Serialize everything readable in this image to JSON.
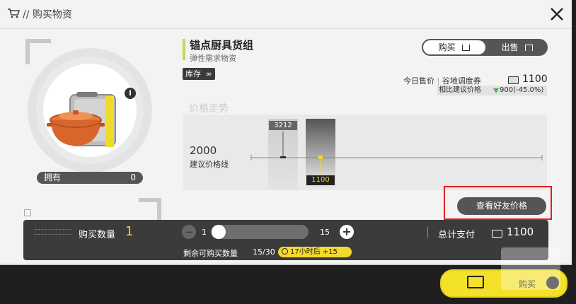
{
  "header": {
    "breadcrumb": "// 购买物资"
  },
  "item": {
    "name": "锚点厨具货组",
    "category": "弹性需求物资",
    "stock_label": "库存",
    "stock_value": "∞",
    "owned_label": "拥有",
    "owned_value": "0"
  },
  "trade_toggle": {
    "buy": "购买",
    "sell": "出售"
  },
  "price": {
    "today_label": "今日售价",
    "currency_label": "谷地调度券",
    "today_value": "1100",
    "compare_label": "相比建议价格",
    "compare_value": "900(-45.0%)"
  },
  "trend": {
    "title": "价格走势",
    "suggested_value": "2000",
    "suggested_label": "建议价格线",
    "bars": [
      {
        "label": "3212",
        "value": 3212
      },
      {
        "label": "1100",
        "value": 1100
      }
    ]
  },
  "friend_button": "查看好友价格",
  "purchase": {
    "qty_label": "购买数量",
    "qty_value": "1",
    "min": "1",
    "max": "15",
    "total_label": "总计支付",
    "total_value": "1100",
    "remain_label": "剩余可购买数量",
    "remain_value": "15/30",
    "timer": "17小时后 +15"
  },
  "buy_button": "购买",
  "colors": {
    "accent": "#f3da2c",
    "green": "#b9dd55",
    "drop": "#4caf50",
    "highlight": "#e02020"
  }
}
